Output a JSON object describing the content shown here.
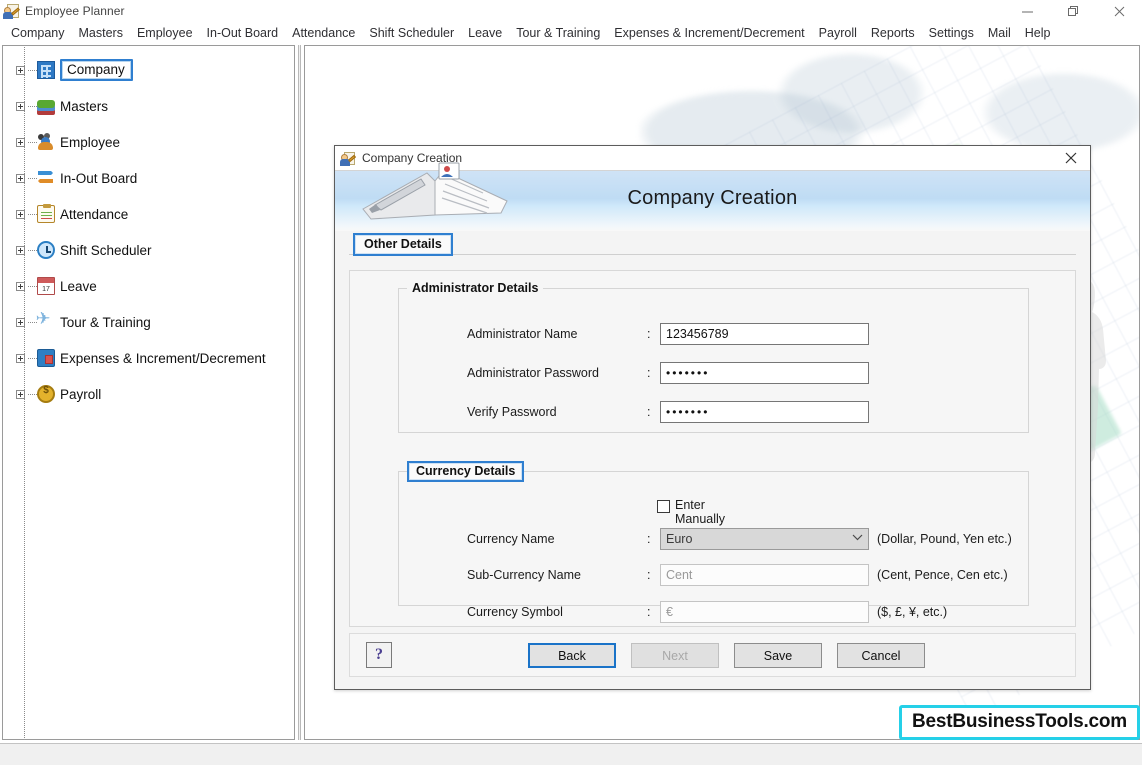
{
  "window": {
    "title": "Employee Planner",
    "app_icon": "employee-planner-icon",
    "minimize": "—",
    "maximize": "restore-icon",
    "close": "✕"
  },
  "menubar": {
    "items": [
      {
        "label": "Company"
      },
      {
        "label": "Masters"
      },
      {
        "label": "Employee"
      },
      {
        "label": "In-Out Board"
      },
      {
        "label": "Attendance"
      },
      {
        "label": "Shift Scheduler"
      },
      {
        "label": "Leave"
      },
      {
        "label": "Tour & Training"
      },
      {
        "label": "Expenses & Increment/Decrement"
      },
      {
        "label": "Payroll"
      },
      {
        "label": "Reports"
      },
      {
        "label": "Settings"
      },
      {
        "label": "Mail"
      },
      {
        "label": "Help"
      }
    ]
  },
  "tree": {
    "items": [
      {
        "label": "Company",
        "icon": "building-icon",
        "selected": true
      },
      {
        "label": "Masters",
        "icon": "layers-icon",
        "selected": false
      },
      {
        "label": "Employee",
        "icon": "people-icon",
        "selected": false
      },
      {
        "label": "In-Out Board",
        "icon": "in-out-arrows-icon",
        "selected": false
      },
      {
        "label": "Attendance",
        "icon": "clipboard-icon",
        "selected": false
      },
      {
        "label": "Shift Scheduler",
        "icon": "clock-icon",
        "selected": false
      },
      {
        "label": "Leave",
        "icon": "calendar-icon",
        "calendar_day": "17",
        "selected": false
      },
      {
        "label": "Tour & Training",
        "icon": "airplane-icon",
        "selected": false
      },
      {
        "label": "Expenses & Increment/Decrement",
        "icon": "wallet-icon",
        "selected": false
      },
      {
        "label": "Payroll",
        "icon": "coin-dollar-icon",
        "selected": false
      }
    ]
  },
  "dialog": {
    "titlebar_text": "Company Creation",
    "titlebar_icon": "company-creation-icon",
    "close_label": "✕",
    "banner_title": "Company Creation",
    "banner_icon": "open-book-pen-icon",
    "tab_label": "Other Details",
    "admin_group": {
      "legend": "Administrator Details",
      "rows": [
        {
          "label": "Administrator Name",
          "colon": ":",
          "value": "123456789",
          "type": "text"
        },
        {
          "label": "Administrator Password",
          "colon": ":",
          "value": "•••••••",
          "type": "password"
        },
        {
          "label": "Verify Password",
          "colon": ":",
          "value": "•••••••",
          "type": "password"
        }
      ]
    },
    "currency_group": {
      "legend": "Currency Details",
      "enter_manually_label": "Enter Manually",
      "enter_manually_checked": false,
      "rows": [
        {
          "label": "Currency Name",
          "colon": ":",
          "value": "Euro",
          "hint": "(Dollar, Pound, Yen etc.)",
          "type": "select",
          "chevron": "⌄"
        },
        {
          "label": "Sub-Currency Name",
          "colon": ":",
          "value": "Cent",
          "hint": "(Cent, Pence, Cen etc.)",
          "type": "text",
          "disabled": true
        },
        {
          "label": "Currency Symbol",
          "colon": ":",
          "value": "€",
          "hint": "($, £, ¥, etc.)",
          "type": "text",
          "disabled": true
        }
      ]
    },
    "footer": {
      "help_label": "?",
      "back_label": "Back",
      "next_label": "Next",
      "save_label": "Save",
      "cancel_label": "Cancel"
    }
  },
  "watermark": {
    "text": "BestBusinessTools.com",
    "border_color": "#25d0e8"
  },
  "colors": {
    "accent_blue": "#2f7fd0",
    "focus_blue": "#1a73c8",
    "banner_blue": "#bfdcf4",
    "watermark_cyan": "#25d0e8"
  }
}
